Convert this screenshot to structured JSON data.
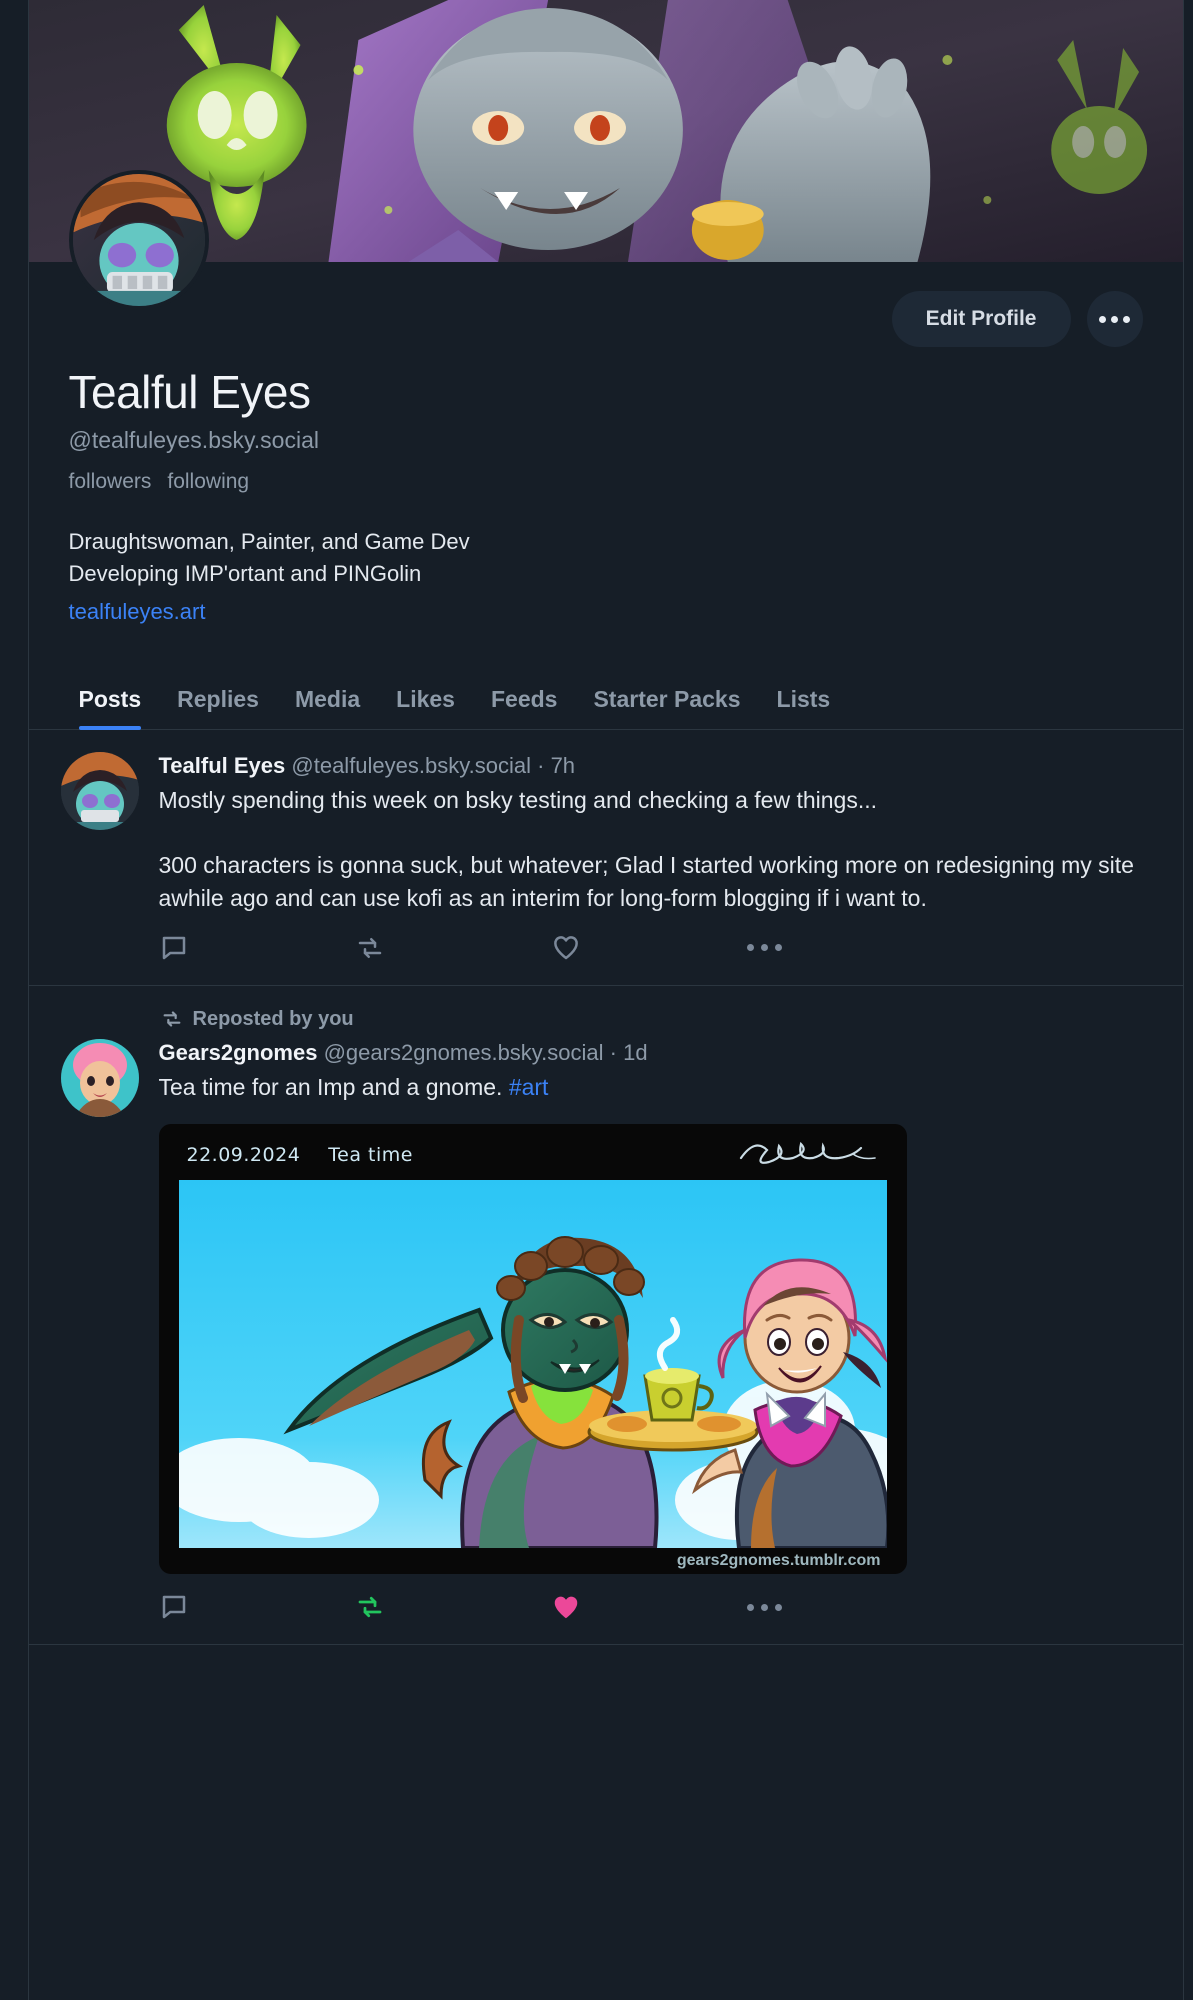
{
  "profile": {
    "display_name": "Tealful Eyes",
    "handle": "@tealfuleyes.bsky.social",
    "followers_label": "followers",
    "following_label": "following",
    "bio_line1": "Draughtswoman, Painter, and Game Dev",
    "bio_line2": "Developing IMP'ortant and PINGolin",
    "website": "tealfuleyes.art",
    "edit_button": "Edit Profile",
    "more_button": "more-options"
  },
  "tabs": [
    {
      "label": "Posts",
      "active": true
    },
    {
      "label": "Replies",
      "active": false
    },
    {
      "label": "Media",
      "active": false
    },
    {
      "label": "Likes",
      "active": false
    },
    {
      "label": "Feeds",
      "active": false
    },
    {
      "label": "Starter Packs",
      "active": false
    },
    {
      "label": "Lists",
      "active": false
    }
  ],
  "posts": [
    {
      "author": "Tealful Eyes",
      "handle": "@tealfuleyes.bsky.social",
      "separator": "·",
      "time": "7h",
      "text": "Mostly spending this week on bsky testing and checking a few things...\n\n300 characters is gonna suck, but whatever; Glad I started working more on redesigning my site awhile ago and can use kofi as an interim for long-form blogging if i want to."
    },
    {
      "repost_label": "Reposted by you",
      "author": "Gears2gnomes",
      "handle": "@gears2gnomes.bsky.social",
      "separator": "·",
      "time": "1d",
      "text": "Tea time for an Imp and a gnome.",
      "hashtag": "#art",
      "embed": {
        "date": "22.09.2024",
        "title": "Tea time",
        "signature": "Sig",
        "watermark": "gears2gnomes.tumblr.com"
      }
    }
  ],
  "colors": {
    "accent": "#3b82f6",
    "like_active": "#ec4899",
    "repost_active": "#22c55e",
    "background": "#161e27",
    "muted_text": "#8d9aa8"
  }
}
